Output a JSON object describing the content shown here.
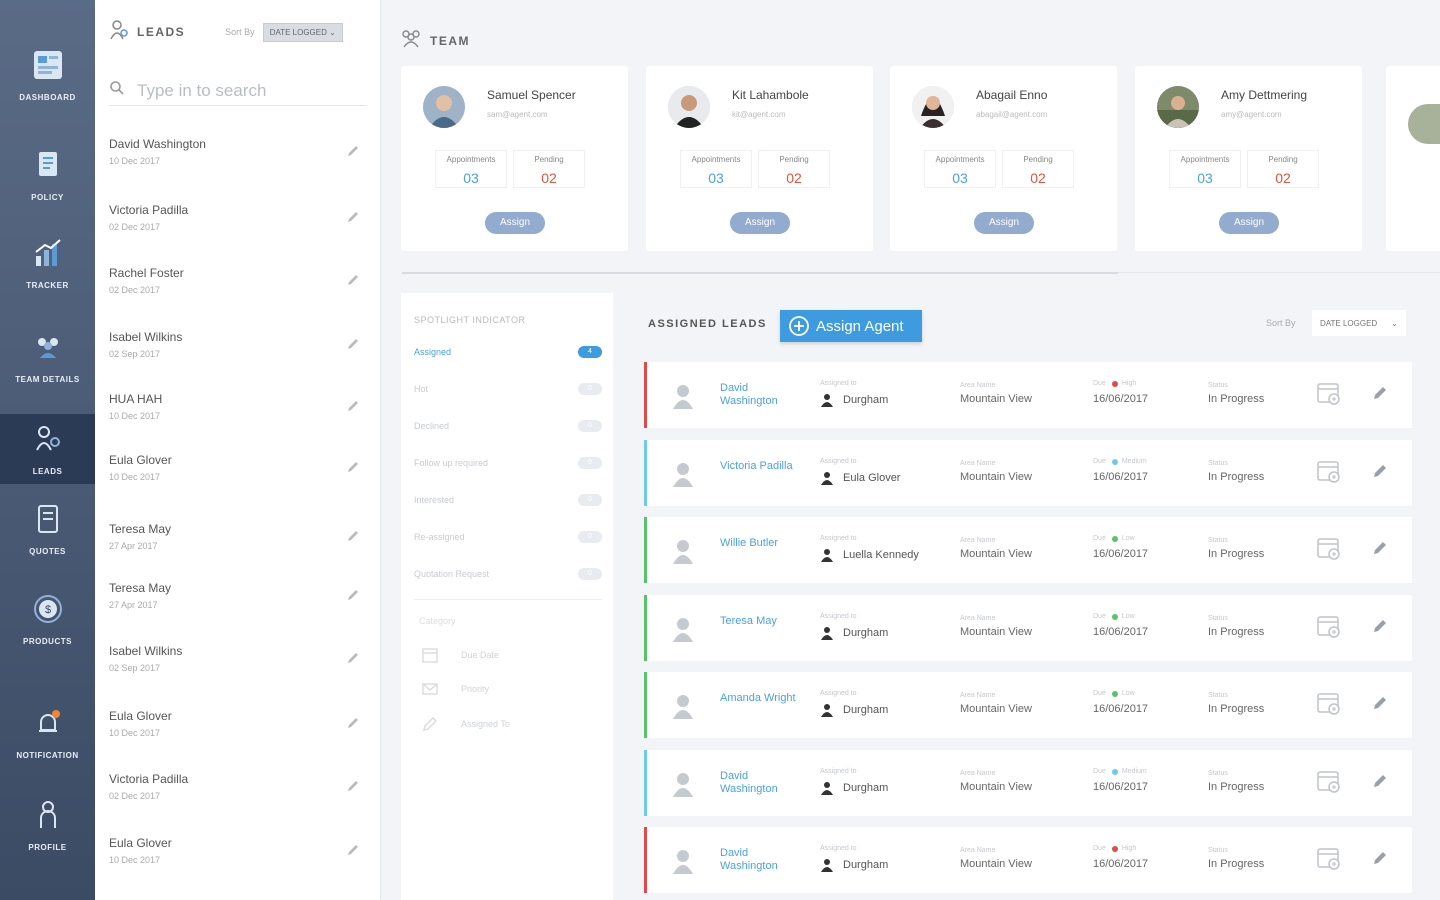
{
  "colors": {
    "accent": "#3e9be0",
    "sidebar": "#3c4b64",
    "high": "#e04a4a",
    "medium": "#6ccbe8",
    "low": "#57c46a"
  },
  "sidebar": {
    "items": [
      {
        "label": "DASHBOARD",
        "icon": "dashboard-icon"
      },
      {
        "label": "POLICY",
        "icon": "policy-icon"
      },
      {
        "label": "TRACKER",
        "icon": "tracker-icon"
      },
      {
        "label": "TEAM DETAILS",
        "icon": "team-icon"
      },
      {
        "label": "LEADS",
        "icon": "leads-icon",
        "active": true
      },
      {
        "label": "QUOTES",
        "icon": "quotes-icon"
      },
      {
        "label": "PRODUCTS",
        "icon": "products-icon"
      },
      {
        "label": "NOTIFICATION",
        "icon": "notification-icon"
      },
      {
        "label": "PROFILE",
        "icon": "profile-icon"
      }
    ]
  },
  "leads": {
    "title": "LEADS",
    "sort_label": "Sort By",
    "sort_value": "DATE LOGGED",
    "search_placeholder": "Type in to search",
    "items": [
      {
        "name": "David Washington",
        "date": "10 Dec 2017"
      },
      {
        "name": "Victoria Padilla",
        "date": "02 Dec 2017"
      },
      {
        "name": "Rachel Foster",
        "date": "02 Dec 2017"
      },
      {
        "name": "Isabel Wilkins",
        "date": "02 Sep 2017"
      },
      {
        "name": "HUA HAH",
        "date": "10 Dec 2017"
      },
      {
        "name": "Eula Glover",
        "date": "10 Dec 2017"
      },
      {
        "name": "Teresa May",
        "date": "27 Apr 2017"
      },
      {
        "name": "Teresa May",
        "date": "27 Apr 2017"
      },
      {
        "name": "Isabel Wilkins",
        "date": "02 Sep 2017"
      },
      {
        "name": "Eula Glover",
        "date": "10 Dec 2017"
      },
      {
        "name": "Victoria Padilla",
        "date": "02 Dec 2017"
      },
      {
        "name": "Eula Glover",
        "date": "10 Dec 2017"
      }
    ]
  },
  "team": {
    "title": "TEAM",
    "appointments_label": "Appointments",
    "pending_label": "Pending",
    "assign_label": "Assign",
    "members": [
      {
        "name": "Samuel Spencer",
        "email": "sam@agent.com",
        "appointments": "03",
        "pending": "02"
      },
      {
        "name": "Kit Lahambole",
        "email": "kit@agent.com",
        "appointments": "03",
        "pending": "02"
      },
      {
        "name": "Abagail Enno",
        "email": "abagail@agent.com",
        "appointments": "03",
        "pending": "02"
      },
      {
        "name": "Amy Dettmering",
        "email": "amy@agent.com",
        "appointments": "03",
        "pending": "02"
      }
    ]
  },
  "spotlight": {
    "title": "SPOTLIGHT INDICATOR",
    "filters": [
      {
        "label": "Assigned",
        "count": "4",
        "active": true
      },
      {
        "label": "Hot",
        "count": "0"
      },
      {
        "label": "Declined",
        "count": "0"
      },
      {
        "label": "Follow up required",
        "count": "0"
      },
      {
        "label": "Interested",
        "count": "0"
      },
      {
        "label": "Re-assigned",
        "count": "0"
      },
      {
        "label": "Quotation Request",
        "count": "0"
      }
    ],
    "category": "Category",
    "sort_options": [
      {
        "label": "Due Date",
        "icon": "calendar-icon"
      },
      {
        "label": "Priority",
        "icon": "mail-icon"
      },
      {
        "label": "Assigned To",
        "icon": "pencil-icon"
      }
    ]
  },
  "assigned_leads": {
    "title": "ASSIGNED LEADS",
    "assign_agent_label": "Assign Agent",
    "sort_label": "Sort By",
    "sort_value": "DATE LOGGED",
    "assigned_to_label": "Assigned to",
    "area_label": "Area Name",
    "due_label": "Due",
    "status_label": "Status",
    "rows": [
      {
        "name": "David Washington",
        "assigned_to": "Durgham",
        "area": "Mountain View",
        "priority": "High",
        "priority_level": "high",
        "due": "16/06/2017",
        "status": "In Progress"
      },
      {
        "name": "Victoria Padilla",
        "assigned_to": "Eula Glover",
        "area": "Mountain View",
        "priority": "Medium",
        "priority_level": "medium",
        "due": "16/06/2017",
        "status": "In Progress"
      },
      {
        "name": "Willie Butler",
        "assigned_to": "Luella Kennedy",
        "area": "Mountain View",
        "priority": "Low",
        "priority_level": "low",
        "due": "16/06/2017",
        "status": "In Progress"
      },
      {
        "name": "Teresa May",
        "assigned_to": "Durgham",
        "area": "Mountain View",
        "priority": "Low",
        "priority_level": "low",
        "due": "16/06/2017",
        "status": "In Progress"
      },
      {
        "name": "Amanda Wright",
        "assigned_to": "Durgham",
        "area": "Mountain View",
        "priority": "Low",
        "priority_level": "low",
        "due": "16/06/2017",
        "status": "In Progress"
      },
      {
        "name": "David Washington",
        "assigned_to": "Durgham",
        "area": "Mountain View",
        "priority": "Medium",
        "priority_level": "medium",
        "due": "16/06/2017",
        "status": "In Progress"
      },
      {
        "name": "David Washington",
        "assigned_to": "Durgham",
        "area": "Mountain View",
        "priority": "High",
        "priority_level": "high",
        "due": "16/06/2017",
        "status": "In Progress"
      }
    ]
  }
}
